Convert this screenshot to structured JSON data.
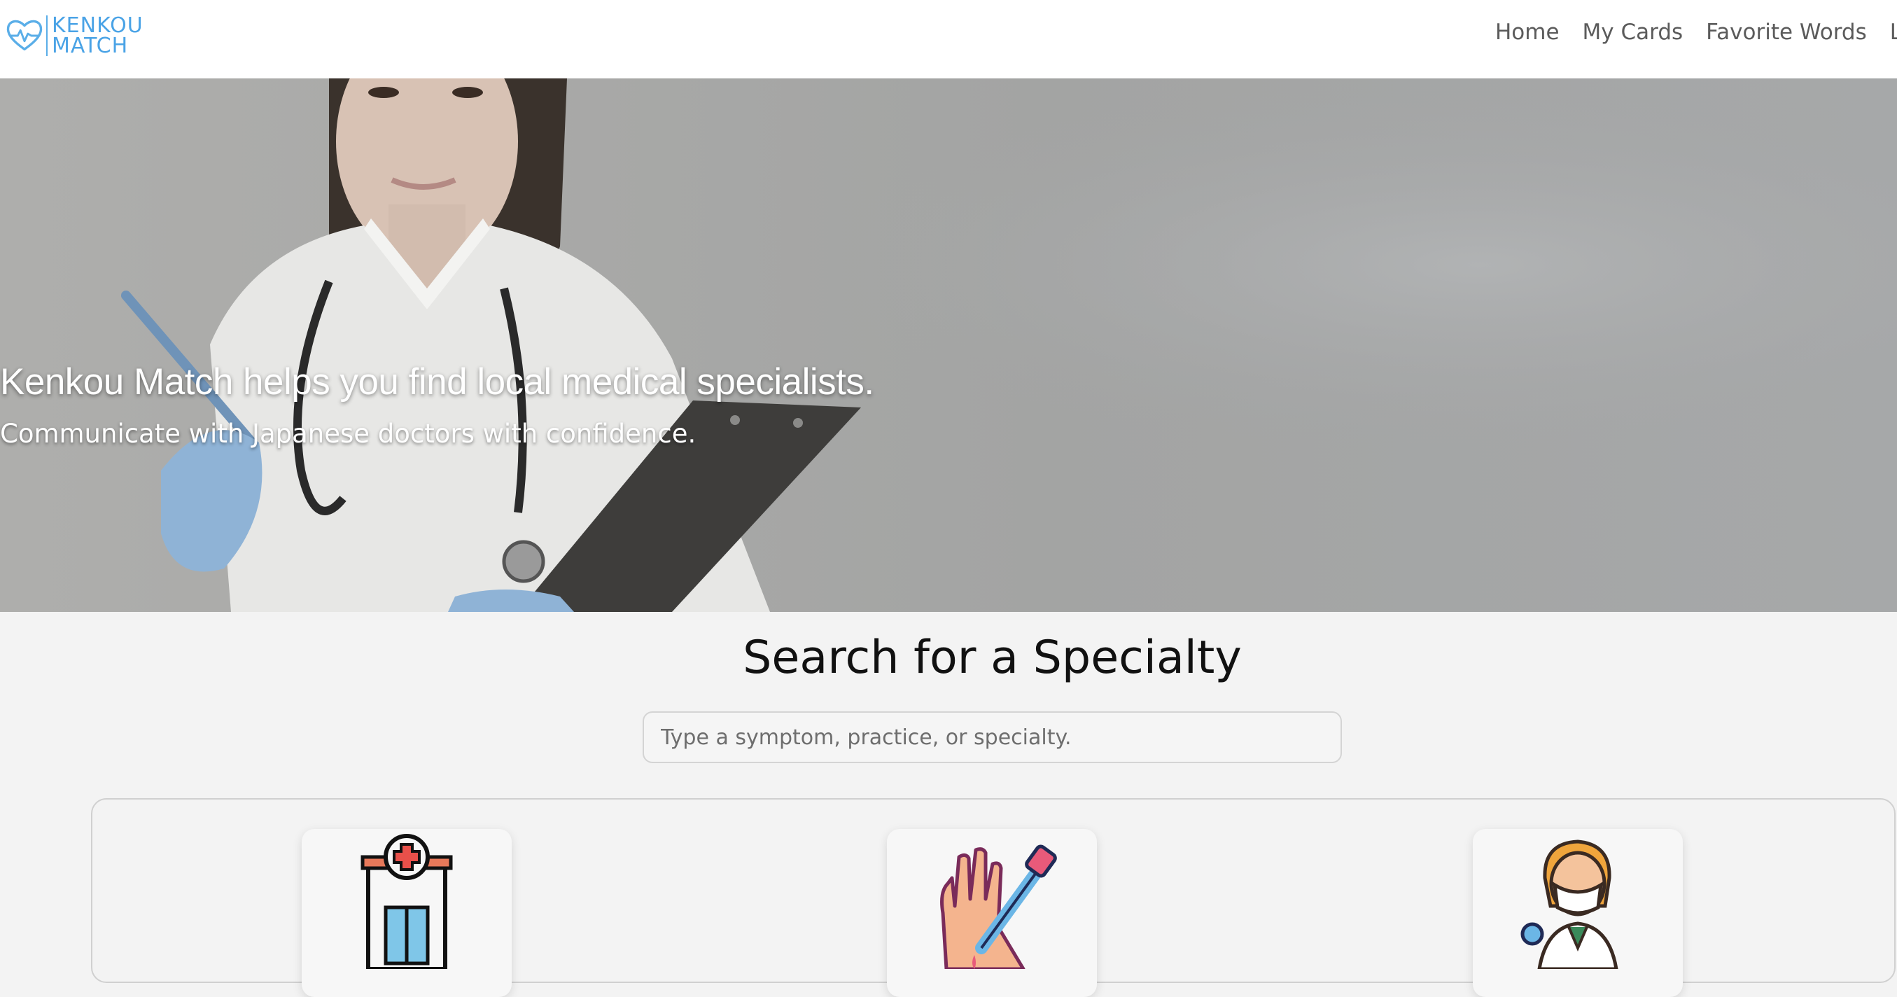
{
  "brand": {
    "line1": "KENKOU",
    "line2": "MATCH",
    "accent": "#4aa3e6"
  },
  "nav": {
    "links": [
      {
        "label": "Home"
      },
      {
        "label": "My Cards"
      },
      {
        "label": "Favorite Words"
      },
      {
        "label": "L"
      }
    ]
  },
  "hero": {
    "title": "Kenkou Match helps you find local medical specialists.",
    "subtitle": "Communicate with Japanese doctors with confidence."
  },
  "search": {
    "title": "Search for a Specialty",
    "placeholder": "Type a symptom, practice, or specialty.",
    "value": ""
  },
  "cards": [
    {
      "icon": "hospital-icon"
    },
    {
      "icon": "blood-test-icon"
    },
    {
      "icon": "doctor-icon"
    }
  ]
}
